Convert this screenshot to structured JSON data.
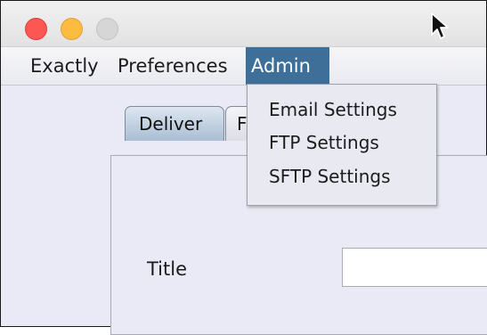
{
  "window": {
    "buttons": [
      "close",
      "minimize",
      "zoom"
    ],
    "icons": {
      "close": "close-dot-icon",
      "minimize": "minimize-dot-icon",
      "zoom": "zoom-dot-icon",
      "cursor": "mouse-pointer-icon"
    },
    "colors": {
      "close": "#fc5753",
      "minimize": "#fdbc40",
      "zoom": "#d6d6d6",
      "menu_highlight": "#3d6f98"
    }
  },
  "menubar": {
    "items": [
      {
        "label": "Exactly"
      },
      {
        "label": "Preferences"
      },
      {
        "label": "Admin",
        "open": true
      }
    ]
  },
  "admin_menu": {
    "items": [
      {
        "label": "Email Settings"
      },
      {
        "label": "FTP Settings"
      },
      {
        "label": "SFTP Settings"
      }
    ]
  },
  "tabs": [
    {
      "label": "Deliver",
      "selected": true
    },
    {
      "label": "F",
      "selected": false
    }
  ],
  "form": {
    "title_label": "Title",
    "title_value": ""
  }
}
